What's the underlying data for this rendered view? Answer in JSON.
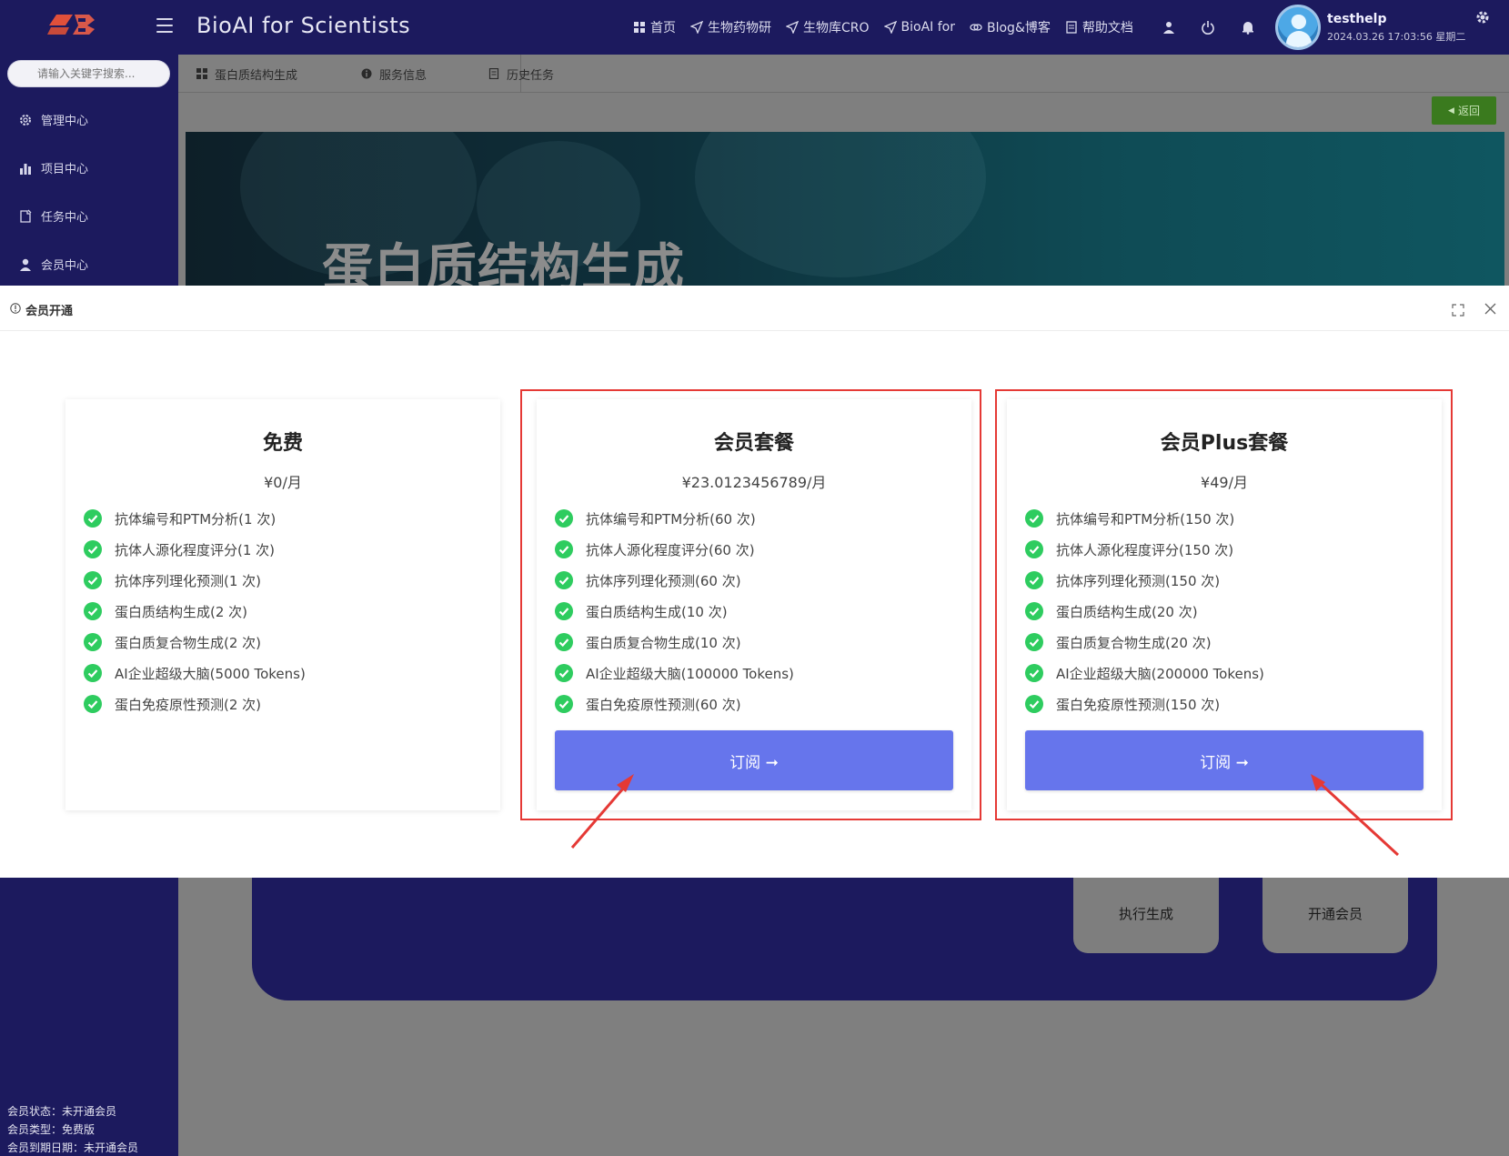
{
  "header": {
    "title": "BioAI for Scientists",
    "nav": [
      {
        "label": "首页",
        "icon": "grid-icon"
      },
      {
        "label": "生物药物研",
        "icon": "send-icon"
      },
      {
        "label": "生物库CRO",
        "icon": "send-icon"
      },
      {
        "label": "BioAI for",
        "icon": "send-icon"
      },
      {
        "label": "Blog&博客",
        "icon": "link-icon"
      },
      {
        "label": "帮助文档",
        "icon": "doc-icon"
      }
    ],
    "user": {
      "name": "testhelp",
      "datetime": "2024.03.26 17:03:56 星期二"
    }
  },
  "sidebar": {
    "search_placeholder": "请输入关键字搜索...",
    "items": [
      {
        "label": "管理中心",
        "icon": "gear-icon"
      },
      {
        "label": "项目中心",
        "icon": "bar-chart-icon"
      },
      {
        "label": "任务中心",
        "icon": "task-icon"
      },
      {
        "label": "会员中心",
        "icon": "user-icon"
      }
    ],
    "footer": {
      "status": "会员状态：未开通会员",
      "type": "会员类型：免费版",
      "expiry": "会员到期日期：未开通会员"
    }
  },
  "tabs": [
    {
      "label": "蛋白质结构生成",
      "icon": "grid-icon"
    },
    {
      "label": "服务信息",
      "icon": "info-icon"
    },
    {
      "label": "历史任务",
      "icon": "doc-icon"
    }
  ],
  "back_label": "返回",
  "banner_title": "蛋白质结构生成",
  "actions": {
    "run": "执行生成",
    "open_member": "开通会员"
  },
  "modal": {
    "title": "会员开通",
    "plans": [
      {
        "title": "免费",
        "price": "¥0/月",
        "features": [
          "抗体编号和PTM分析(1 次)",
          "抗体人源化程度评分(1 次)",
          "抗体序列理化预测(1 次)",
          "蛋白质结构生成(2 次)",
          "蛋白质复合物生成(2 次)",
          "AI企业超级大脑(5000 Tokens)",
          "蛋白免疫原性预测(2 次)"
        ]
      },
      {
        "title": "会员套餐",
        "price": "¥23.0123456789/月",
        "features": [
          "抗体编号和PTM分析(60 次)",
          "抗体人源化程度评分(60 次)",
          "抗体序列理化预测(60 次)",
          "蛋白质结构生成(10 次)",
          "蛋白质复合物生成(10 次)",
          "AI企业超级大脑(100000 Tokens)",
          "蛋白免疫原性预测(60 次)"
        ],
        "button": "订阅 ➞"
      },
      {
        "title": "会员Plus套餐",
        "price": "¥49/月",
        "features": [
          "抗体编号和PTM分析(150 次)",
          "抗体人源化程度评分(150 次)",
          "抗体序列理化预测(150 次)",
          "蛋白质结构生成(20 次)",
          "蛋白质复合物生成(20 次)",
          "AI企业超级大脑(200000 Tokens)",
          "蛋白免疫原性预测(150 次)"
        ],
        "button": "订阅 ➞"
      }
    ]
  },
  "colors": {
    "header_bg": "#1c1a5e",
    "button_blue": "#6675ec",
    "check_green": "#2ecc5f",
    "highlight_red": "#e53935",
    "back_green": "#3a7a1e"
  }
}
